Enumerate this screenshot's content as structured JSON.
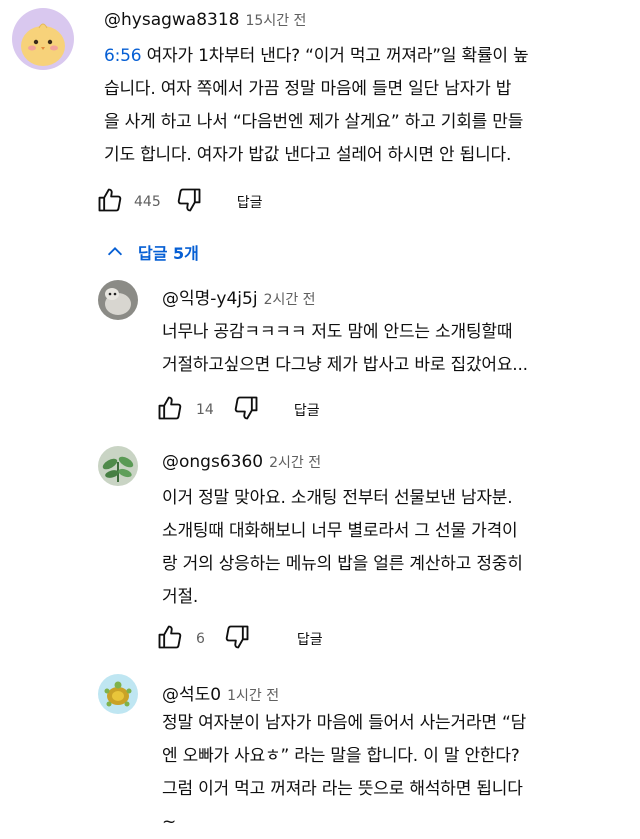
{
  "main_comment": {
    "handle": "@hysagwa8318",
    "time": "15시간 전",
    "timestamp_link": "6:56",
    "lines": [
      " 여자가 1차부터 낸다? “이거 먹고 꺼져라”일 확률이 높",
      "습니다. 여자 쪽에서 가끔 정말 마음에 들면 일단 남자가 밥",
      "을 사게 하고 나서 “다음번엔 제가 살게요” 하고 기회를 만들",
      "기도 합니다. 여자가 밥값 낸다고 설레어 하시면 안 됩니다."
    ],
    "like_count": "445",
    "reply_label": "답글"
  },
  "replies_toggle": {
    "label": "답글 5개",
    "icon": "chevron-up-icon"
  },
  "replies": [
    {
      "handle": "@익명-y4j5j",
      "time": "2시간 전",
      "lines": [
        "너무나 공감ㅋㅋㅋㅋ 저도 맘에 안드는 소개팅할때",
        "거절하고싶으면 다그냥 제가 밥사고 바로 집갔어요..."
      ],
      "like_count": "14",
      "reply_label": "답글"
    },
    {
      "handle": "@ongs6360",
      "time": "2시간 전",
      "lines": [
        "이거 정말 맞아요. 소개팅 전부터 선물보낸 남자분.",
        "소개팅때 대화해보니 너무 별로라서 그 선물 가격이",
        "랑 거의 상응하는 메뉴의 밥을 얼른 계산하고 정중히",
        "거절."
      ],
      "like_count": "6",
      "reply_label": "답글"
    },
    {
      "handle": "@석도0",
      "time": "1시간 전",
      "lines": [
        "정말 여자분이 남자가 마음에 들어서 사는거라면 “담",
        "엔 오빠가 사요ㅎ” 라는 말을 합니다. 이 말 안한다?",
        "그럼 이거 먹고 꺼져라 라는 뜻으로 해석하면 됩니다",
        "~"
      ]
    }
  ],
  "colors": {
    "link": "#065fd4",
    "secondary": "#606060",
    "text": "#0f0f0f"
  }
}
